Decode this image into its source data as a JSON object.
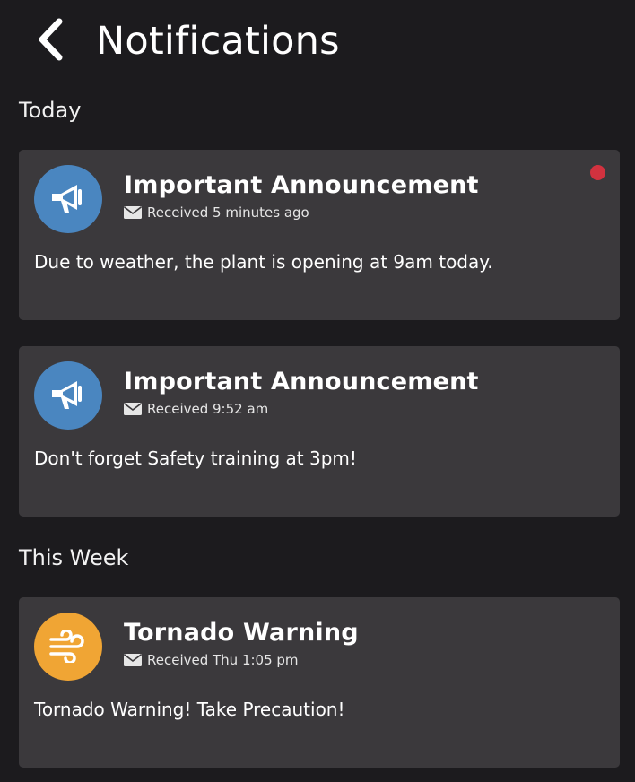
{
  "header": {
    "title": "Notifications",
    "back_icon": "chevron-left-icon"
  },
  "sections": [
    {
      "title": "Today"
    },
    {
      "title": "This Week"
    }
  ],
  "notifications": [
    {
      "title": "Important Announcement",
      "received": "Received 5 minutes ago",
      "body": "Due to weather, the plant is opening at 9am today.",
      "icon": "megaphone-icon",
      "icon_color": "#4a86c0",
      "unread": true
    },
    {
      "title": "Important Announcement",
      "received": "Received 9:52 am",
      "body": "Don't forget Safety training at 3pm!",
      "icon": "megaphone-icon",
      "icon_color": "#4a86c0",
      "unread": false
    },
    {
      "title": "Tornado Warning",
      "received": "Received Thu 1:05 pm",
      "body": "Tornado Warning! Take Precaution!",
      "icon": "wind-icon",
      "icon_color": "#f0a534",
      "unread": false
    }
  ],
  "colors": {
    "background": "#1c1b1e",
    "card": "#3b393c",
    "unread_dot": "#d2323f"
  }
}
